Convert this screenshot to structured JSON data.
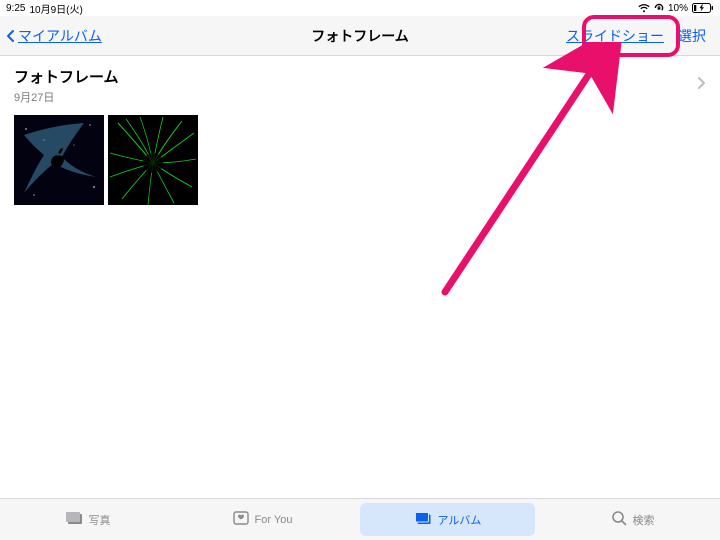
{
  "status": {
    "time": "9:25",
    "date": "10月9日(火)",
    "battery_pct": "10%"
  },
  "nav": {
    "back_label": "マイアルバム",
    "title": "フォトフレーム",
    "slideshow_label": "スライドショー",
    "select_label": "選択"
  },
  "album": {
    "name": "フォトフレーム",
    "date": "9月27日"
  },
  "tabs": {
    "photos": "写真",
    "foryou": "For You",
    "albums": "アルバム",
    "search": "検索"
  },
  "colors": {
    "accent": "#0b61ee",
    "annotation": "#e9106b"
  }
}
